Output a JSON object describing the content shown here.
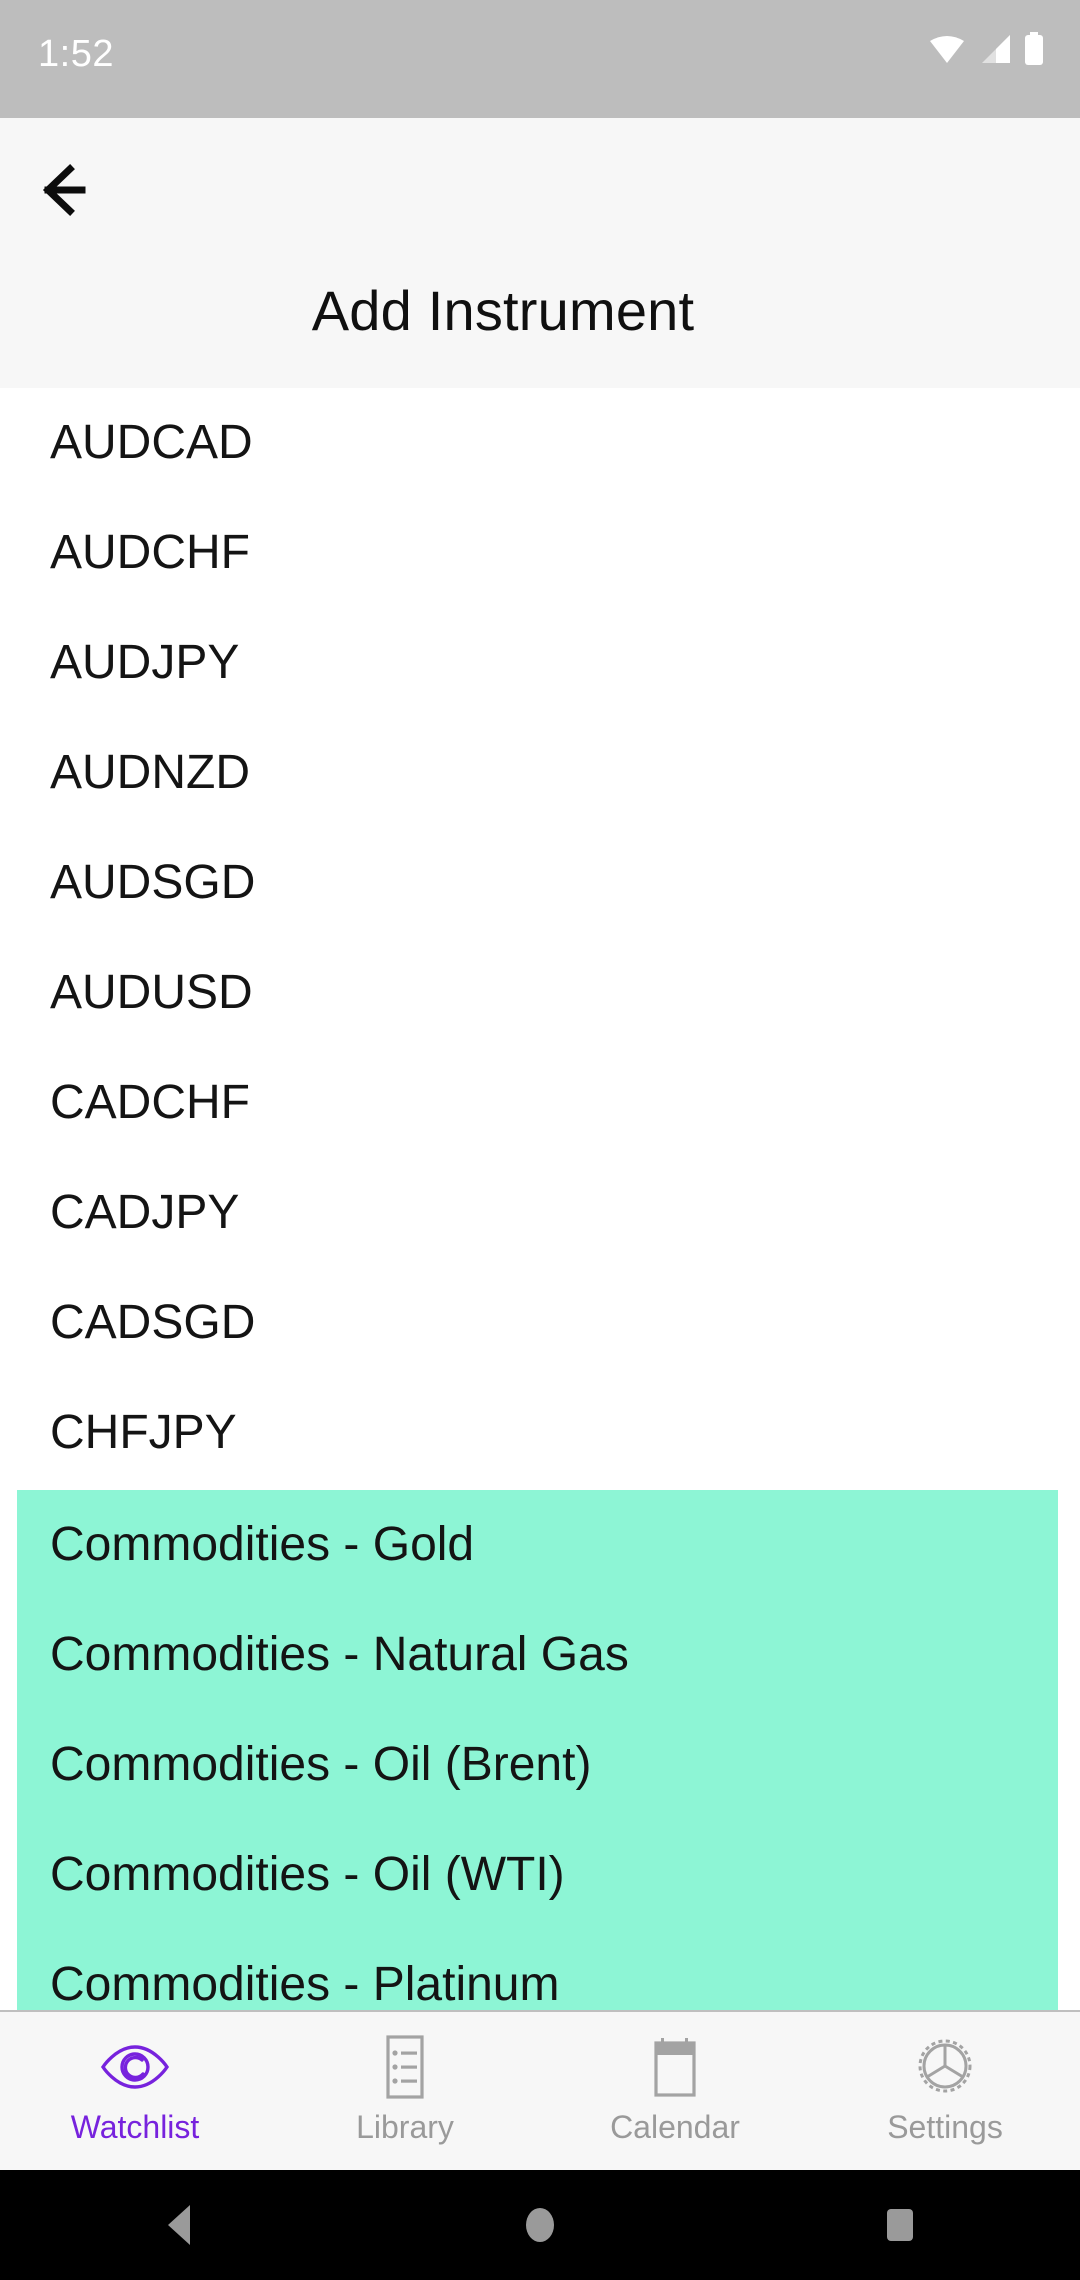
{
  "status_bar": {
    "time": "1:52",
    "icons": [
      "wifi-icon",
      "cellular-signal-icon",
      "battery-icon"
    ],
    "background_color": "#bdbdbd",
    "foreground_color": "#ffffff"
  },
  "app_bar": {
    "back_icon": "arrow-left-icon",
    "title": "Add Instrument",
    "background_color": "#f7f7f7"
  },
  "instrument_list": {
    "unselected_items": [
      {
        "label": "AUDCAD"
      },
      {
        "label": "AUDCHF"
      },
      {
        "label": "AUDJPY"
      },
      {
        "label": "AUDNZD"
      },
      {
        "label": "AUDSGD"
      },
      {
        "label": "AUDUSD"
      },
      {
        "label": "CADCHF"
      },
      {
        "label": "CADJPY"
      },
      {
        "label": "CADSGD"
      },
      {
        "label": "CHFJPY"
      }
    ],
    "selected_items": [
      {
        "label": "Commodities - Gold"
      },
      {
        "label": "Commodities - Natural Gas"
      },
      {
        "label": "Commodities - Oil (Brent)"
      },
      {
        "label": "Commodities - Oil (WTI)"
      },
      {
        "label": "Commodities - Platinum"
      }
    ],
    "selection_highlight_color": "#8df5d5",
    "text_color": "#141414"
  },
  "bottom_nav": {
    "active_color": "#7722dd",
    "inactive_color": "#9a9a9a",
    "items": [
      {
        "label": "Watchlist",
        "icon": "eye-icon",
        "active": true
      },
      {
        "label": "Library",
        "icon": "list-icon",
        "active": false
      },
      {
        "label": "Calendar",
        "icon": "calendar-icon",
        "active": false
      },
      {
        "label": "Settings",
        "icon": "gear-icon",
        "active": false
      }
    ]
  },
  "system_nav": {
    "background_color": "#000000",
    "glyph_color": "#9a9a9a",
    "buttons": [
      {
        "name": "back-triangle-icon"
      },
      {
        "name": "home-circle-icon"
      },
      {
        "name": "recents-square-icon"
      }
    ]
  }
}
